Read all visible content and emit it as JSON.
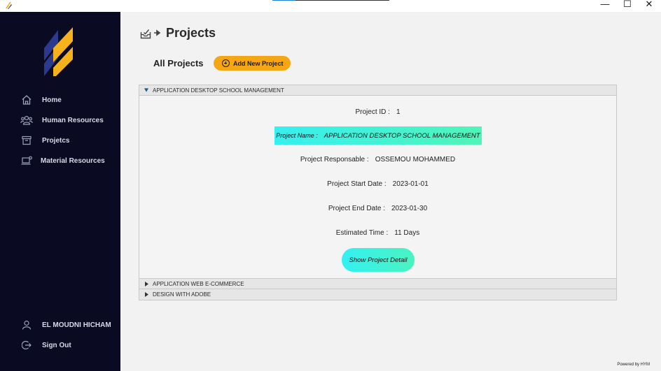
{
  "window": {
    "minimize_glyph": "—",
    "maximize_glyph": "☐",
    "close_glyph": "✕"
  },
  "sidebar": {
    "items": [
      {
        "label": "Home",
        "icon": "home-icon"
      },
      {
        "label": "Human Resources",
        "icon": "people-icon"
      },
      {
        "label": "Projetcs",
        "icon": "archive-icon"
      },
      {
        "label": "Material Resources",
        "icon": "laptop-icon"
      }
    ],
    "user": {
      "label": "EL MOUDNI HICHAM",
      "icon": "user-icon"
    },
    "signout": {
      "label": "Sign Out",
      "icon": "signout-icon"
    }
  },
  "header": {
    "title": "Projects",
    "all_label": "All Projects",
    "add_button": "Add New Project"
  },
  "projects": [
    {
      "header": "APPLICATION DESKTOP SCHOOL MANAGEMENT",
      "expanded": true,
      "id_label": "Project ID :",
      "id_value": "1",
      "name_label": "Project Name :",
      "name_value": "APPLICATION DESKTOP SCHOOL MANAGEMENT",
      "responsable_label": "Project Responsable :",
      "responsable_value": "OSSEMOU MOHAMMED",
      "start_label": "Project Start Date :",
      "start_value": "2023-01-01",
      "end_label": "Project End Date :",
      "end_value": "2023-01-30",
      "estimated_label": "Estimated Time :",
      "estimated_value": "11 Days",
      "detail_button": "Show Project Detail"
    },
    {
      "header": "APPLICATION WEB E-COMMERCE",
      "expanded": false
    },
    {
      "header": "DESIGN WITH ADOBE",
      "expanded": false
    }
  ],
  "footer": {
    "powered": "Powered by HYM"
  },
  "colors": {
    "sidebar_bg": "#0a0b22",
    "accent_orange": "#f5a614",
    "accent_cyan": "#35f0f0",
    "logo_yellow": "#f5b21a",
    "logo_navy": "#2b3a8c"
  }
}
